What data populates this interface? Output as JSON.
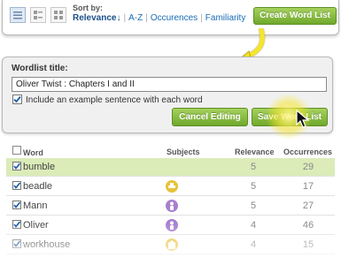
{
  "toolbar": {
    "sort_label": "Sort by:",
    "sort_options": [
      "Relevance↓",
      "A-Z",
      "Occurences",
      "Familiarity"
    ],
    "selected_sort": "Relevance↓",
    "create_button": "Create Word List",
    "views": [
      "list-view-icon",
      "detail-view-icon",
      "grid-view-icon"
    ]
  },
  "panel": {
    "title_label": "Wordlist title:",
    "title_value": "Oliver Twist : Chapters I and II",
    "include_example_label": "Include an example sentence with each word",
    "include_example_checked": true,
    "cancel_button": "Cancel Editing",
    "save_button": "Save Word List"
  },
  "table": {
    "columns": {
      "word": "Word",
      "subjects": "Subjects",
      "relevance": "Relevance",
      "occurrences": "Occurrences"
    },
    "rows": [
      {
        "word": "bumble",
        "subject_icon": "",
        "subject_color": "",
        "relevance": "5",
        "occurrences": "29",
        "checked": true,
        "highlighted": true
      },
      {
        "word": "beadle",
        "subject_icon": "hat-icon",
        "subject_color": "#e6c43a",
        "relevance": "5",
        "occurrences": "17",
        "checked": true,
        "highlighted": false
      },
      {
        "word": "Mann",
        "subject_icon": "person-icon",
        "subject_color": "#a77fcf",
        "relevance": "5",
        "occurrences": "27",
        "checked": true,
        "highlighted": false
      },
      {
        "word": "Oliver",
        "subject_icon": "person-icon",
        "subject_color": "#a77fcf",
        "relevance": "4",
        "occurrences": "46",
        "checked": true,
        "highlighted": false
      },
      {
        "word": "workhouse",
        "subject_icon": "building-icon",
        "subject_color": "#e6c43a",
        "relevance": "4",
        "occurrences": "15",
        "checked": true,
        "highlighted": false
      }
    ]
  },
  "colors": {
    "accent_green": "#7cb342",
    "link_blue": "#1a6db5",
    "highlight_row": "#dbecb9",
    "arrow_yellow": "#f5e52a"
  }
}
